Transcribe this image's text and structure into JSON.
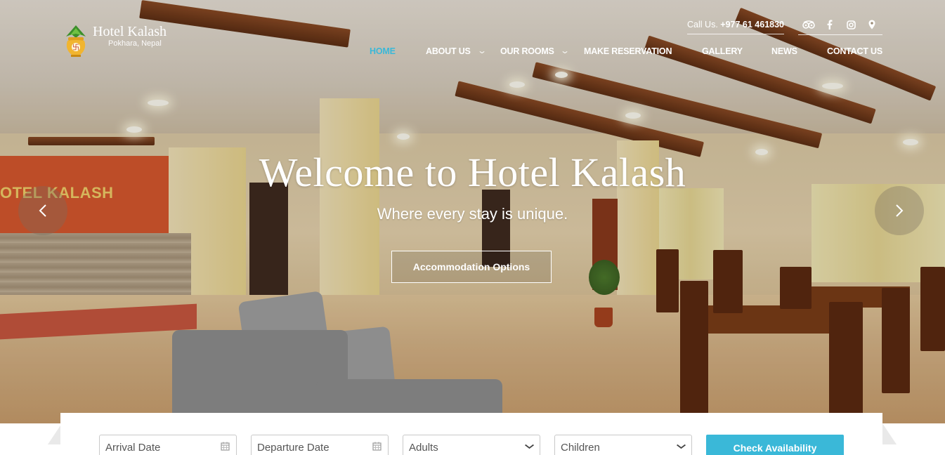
{
  "brand": {
    "name": "Hotel Kalash",
    "location": "Pokhara, Nepal"
  },
  "topbar": {
    "call_label": "Call Us.",
    "phone": "+977 61 461830",
    "social_icons": [
      "tripadvisor-icon",
      "facebook-icon",
      "instagram-icon",
      "map-pin-icon"
    ]
  },
  "nav": {
    "items": [
      {
        "label": "HOME",
        "active": true
      },
      {
        "label": "ABOUT US",
        "has_dropdown": true
      },
      {
        "label": "OUR ROOMS",
        "has_dropdown": true
      },
      {
        "label": "MAKE RESERVATION"
      },
      {
        "label": "GALLERY"
      },
      {
        "label": "NEWS"
      },
      {
        "label": "CONTACT US"
      }
    ]
  },
  "hero": {
    "title": "Welcome to Hotel Kalash",
    "subtitle": "Where every stay is unique.",
    "button_label": "Accommodation Options",
    "wall_sign": "OTEL KALASH",
    "prev_icon": "chevron-left-icon",
    "next_icon": "chevron-right-icon"
  },
  "booking": {
    "arrival_placeholder": "Arrival Date",
    "departure_placeholder": "Departure Date",
    "adults_label": "Adults",
    "children_label": "Children",
    "check_label": "Check Availability"
  },
  "colors": {
    "accent": "#3ab8d8",
    "text_light": "#ffffff"
  }
}
